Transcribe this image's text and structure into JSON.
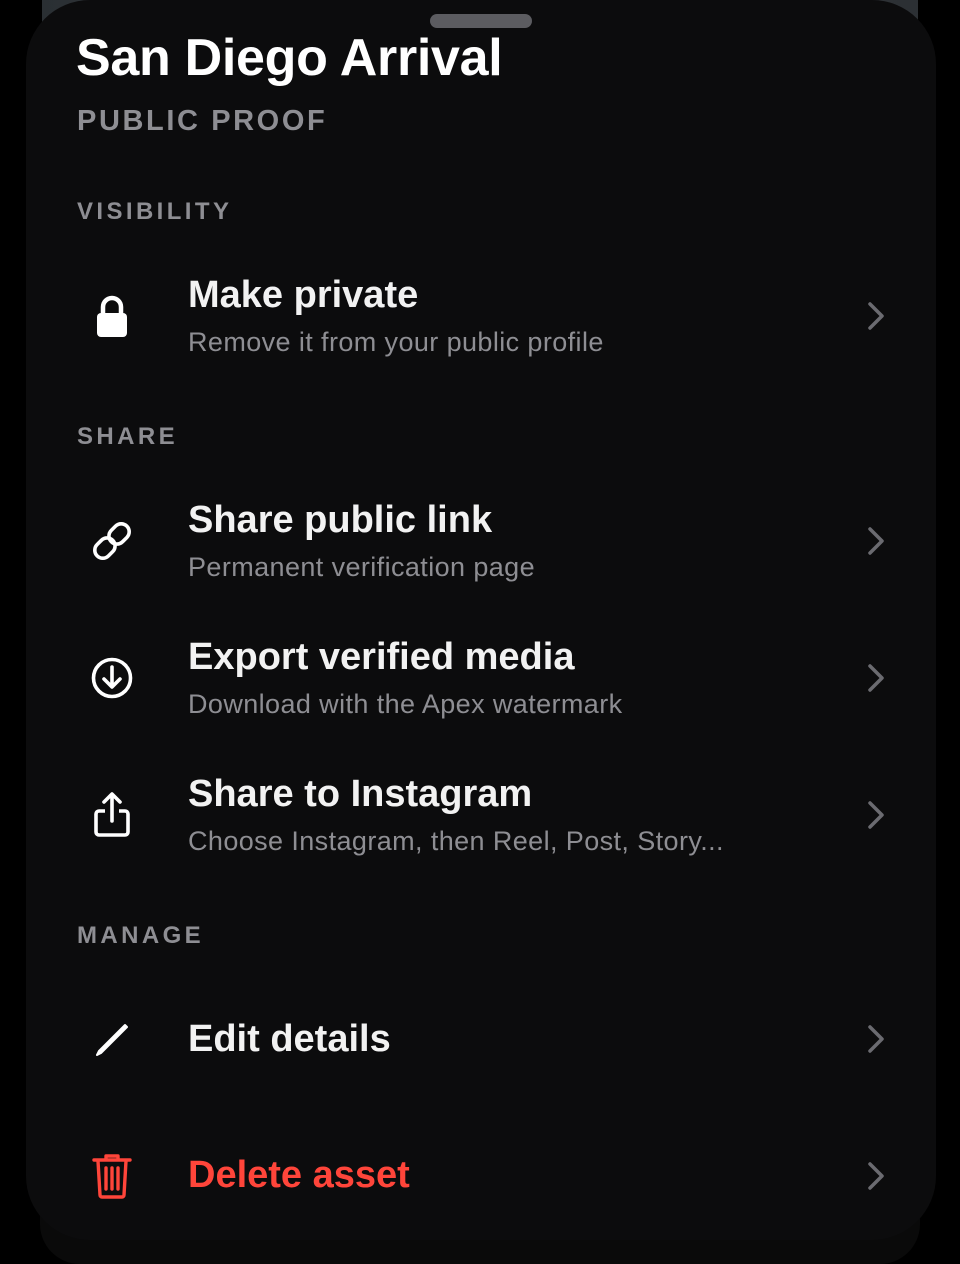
{
  "sheet": {
    "title": "San Diego Arrival",
    "subtitle": "PUBLIC PROOF"
  },
  "sections": {
    "visibility": "VISIBILITY",
    "share": "SHARE",
    "manage": "MANAGE"
  },
  "rows": {
    "make_private": {
      "label": "Make private",
      "description": "Remove it from your public profile",
      "icon": "lock-icon"
    },
    "share_link": {
      "label": "Share public link",
      "description": "Permanent verification page",
      "icon": "link-icon"
    },
    "export_media": {
      "label": "Export verified media",
      "description": "Download with the Apex watermark",
      "icon": "download-circle-icon"
    },
    "share_instagram": {
      "label": "Share to Instagram",
      "description": "Choose Instagram, then Reel, Post, Story...",
      "icon": "share-icon"
    },
    "edit_details": {
      "label": "Edit details",
      "icon": "pencil-icon"
    },
    "delete_asset": {
      "label": "Delete asset",
      "icon": "trash-icon"
    }
  },
  "colors": {
    "background": "#0c0c0d",
    "text": "#f2f2f2",
    "secondary": "#8e8e93",
    "destructive": "#ff453a"
  }
}
